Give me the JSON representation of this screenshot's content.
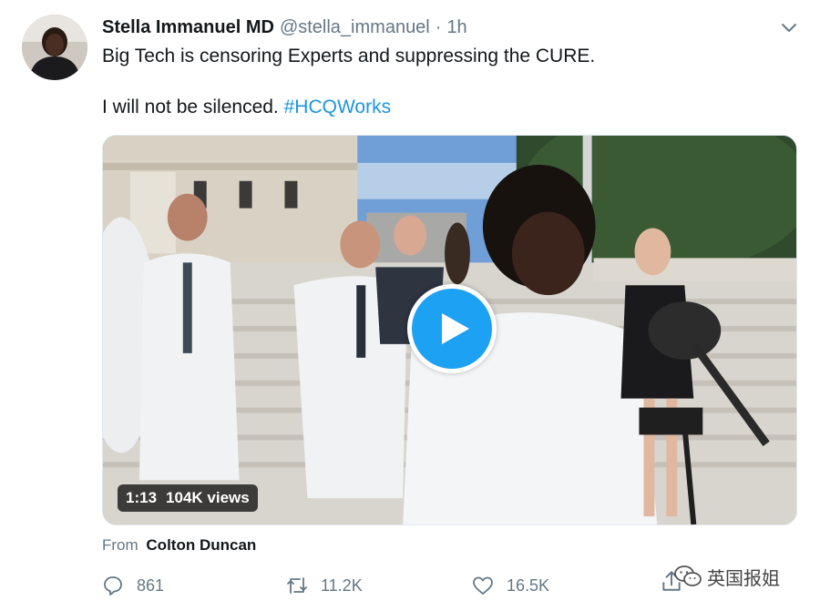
{
  "tweet": {
    "author_name": "Stella Immanuel MD",
    "handle": "@stella_immanuel",
    "separator": "·",
    "timestamp": "1h",
    "text_line1": "Big Tech is censoring Experts and suppressing the CURE.",
    "text_line2": "I will not be silenced.",
    "hashtag": "#HCQWorks",
    "hashtag_color": "#1b95e0"
  },
  "video": {
    "duration": "1:13",
    "views": "104K views",
    "play_color": "#1da1f2"
  },
  "attribution": {
    "prefix": "From",
    "source": "Colton Duncan"
  },
  "actions": {
    "replies": "861",
    "retweets": "11.2K",
    "likes": "16.5K"
  },
  "watermark": {
    "text": "英国报姐",
    "icon": "wechat-icon"
  },
  "icons": [
    "chevron-down-icon",
    "play-icon",
    "reply-icon",
    "retweet-icon",
    "like-icon",
    "share-icon"
  ]
}
